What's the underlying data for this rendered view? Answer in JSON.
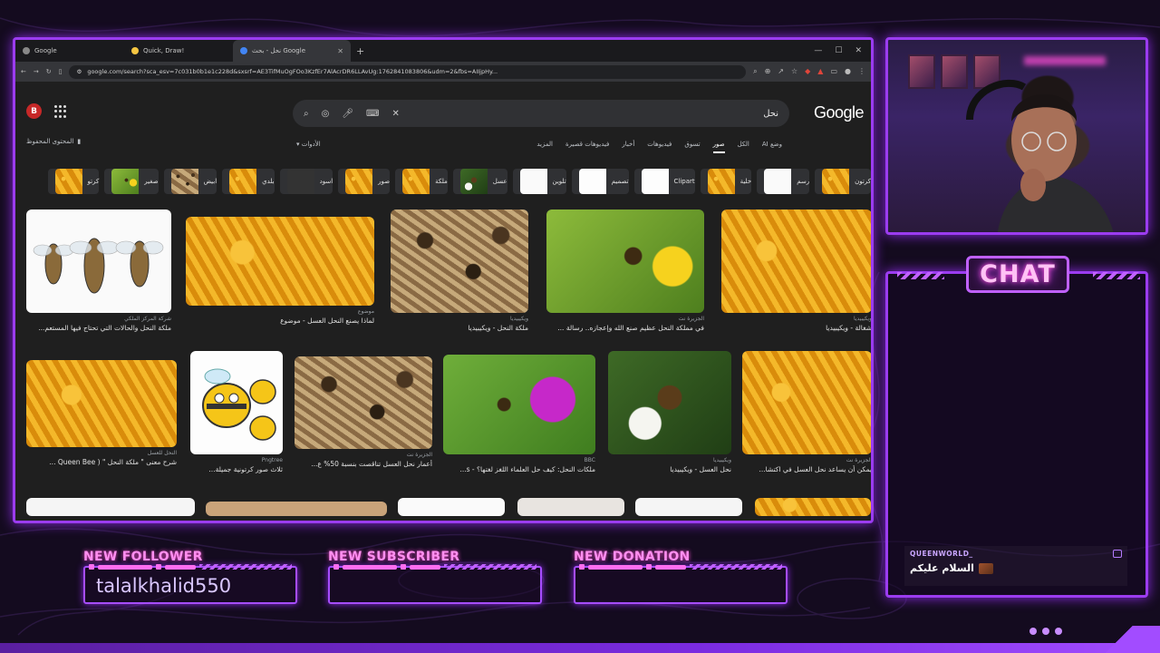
{
  "browser": {
    "tabs": [
      {
        "label": "Google",
        "active": false
      },
      {
        "label": "Quick, Draw!",
        "active": false
      },
      {
        "label": "نحل - بحث Google",
        "active": true
      }
    ],
    "url": "google.com/search?sca_esv=7c031b0b1e1c228d&sxsrf=AE3TifMuOgFOo3KzfEr7AlAcrDR6LLAvUg:1762841083806&udm=2&fbs=AIIjpHy..."
  },
  "google": {
    "avatar_letter": "B",
    "logo": "Google",
    "query": "نحل",
    "saved_content": "المحتوى المحفوظ",
    "tools": "الأدوات",
    "nav_tabs": [
      "وضع AI",
      "الكل",
      "صور",
      "تسوق",
      "فيديوهات",
      "أخبار",
      "فيديوهات قصيرة",
      "المزيد"
    ],
    "active_tab": "صور",
    "chips": [
      "كرتون",
      "رسم",
      "خلية",
      "Clipart",
      "تصميم",
      "تلوين",
      "عسل",
      "ملكة",
      "صور",
      "اسود",
      "بلدي",
      "ابيض",
      "صغير",
      "كرتو"
    ],
    "row1": [
      {
        "source": "شركة المركز الملكي",
        "caption": "ملكة النحل والحالات التي تحتاج فيها المستعم...",
        "style": "diagram-bees"
      },
      {
        "source": "موضوع",
        "caption": "لماذا يصنع النحل العسل - موضوع",
        "style": "honey"
      },
      {
        "source": "ويكيبيديا",
        "caption": "ملكة النحل - ويكيبيديا",
        "style": "bees-dark"
      },
      {
        "source": "الجزيرة نت",
        "caption": "في مملكة النحل عظيم صنع الله وإعجازه.. رسالة ...",
        "style": "green-flower"
      },
      {
        "source": "ويكيبيديا",
        "caption": "شغالة - ويكيبيديا",
        "style": "honey"
      }
    ],
    "row2": [
      {
        "source": "النحل للعسل",
        "caption": "شرح معنى \" ملكة النحل \" ( Queen Bee ...",
        "style": "honey"
      },
      {
        "source": "Pngtree",
        "caption": "ثلاث صور كرتونية جميلة...",
        "style": "cartoon-bees"
      },
      {
        "source": "الجزيرة نت",
        "caption": "أعمار نحل العسل تناقصت بنسبة 50% ع...",
        "style": "bees-dark"
      },
      {
        "source": "BBC",
        "caption": "ملكات النحل: كيف حل العلماء اللغز لغتها؟ - s...",
        "style": "purple-flower"
      },
      {
        "source": "ويكيبيديا",
        "caption": "نحل العسل - ويكيبيديا",
        "style": "white-flower"
      },
      {
        "source": "الجزيرة نت",
        "caption": "يمكن أن يساعد نحل العسل في اكتشا...",
        "style": "honey"
      }
    ]
  },
  "overlay": {
    "chat_title": "CHAT",
    "chat_message": {
      "user": "QUEENWORLD_",
      "text": "السلام عليكم"
    },
    "alerts": [
      {
        "label": "NEW FOLLOWER",
        "value": "talalkhalid550"
      },
      {
        "label": "NEW SUBSCRIBER",
        "value": ""
      },
      {
        "label": "NEW DONATION",
        "value": ""
      }
    ]
  }
}
